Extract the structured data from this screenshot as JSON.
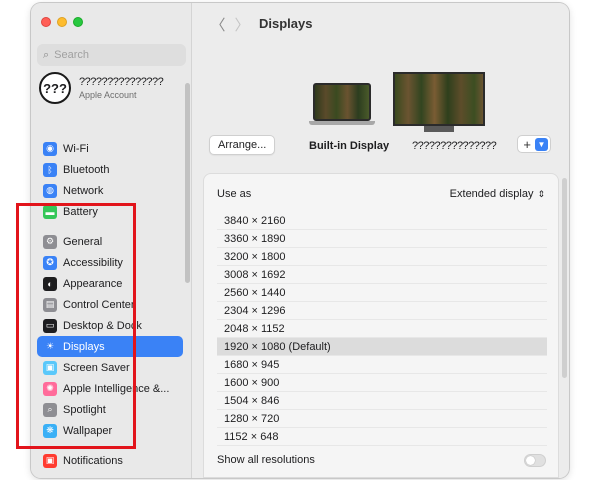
{
  "window": {
    "title": "Displays"
  },
  "search": {
    "placeholder": "Search"
  },
  "account": {
    "avatar_text": "???",
    "name": "???????????????",
    "subtitle": "Apple Account"
  },
  "sidebar": {
    "items": [
      {
        "label": "Wi-Fi",
        "icon": "wifi-icon",
        "color": "#3a82f6",
        "glyph": "◉",
        "name": "sidebar-item-wifi",
        "selected": false,
        "gap_before": false
      },
      {
        "label": "Bluetooth",
        "icon": "bluetooth-icon",
        "color": "#3a82f6",
        "glyph": "ᛒ",
        "name": "sidebar-item-bluetooth",
        "selected": false,
        "gap_before": false
      },
      {
        "label": "Network",
        "icon": "network-icon",
        "color": "#3a82f6",
        "glyph": "◍",
        "name": "sidebar-item-network",
        "selected": false,
        "gap_before": false
      },
      {
        "label": "Battery",
        "icon": "battery-icon",
        "color": "#34c759",
        "glyph": "▬",
        "name": "sidebar-item-battery",
        "selected": false,
        "gap_before": false
      },
      {
        "label": "General",
        "icon": "gear-icon",
        "color": "#8e8e93",
        "glyph": "⚙",
        "name": "sidebar-item-general",
        "selected": false,
        "gap_before": true
      },
      {
        "label": "Accessibility",
        "icon": "accessibility-icon",
        "color": "#3a82f6",
        "glyph": "✪",
        "name": "sidebar-item-accessibility",
        "selected": false,
        "gap_before": false
      },
      {
        "label": "Appearance",
        "icon": "appearance-icon",
        "color": "#1d1d1f",
        "glyph": "◐",
        "name": "sidebar-item-appearance",
        "selected": false,
        "gap_before": false
      },
      {
        "label": "Control Center",
        "icon": "control-center-icon",
        "color": "#8e8e93",
        "glyph": "▤",
        "name": "sidebar-item-control-center",
        "selected": false,
        "gap_before": false
      },
      {
        "label": "Desktop & Dock",
        "icon": "desktop-dock-icon",
        "color": "#1d1d1f",
        "glyph": "▭",
        "name": "sidebar-item-desktop-dock",
        "selected": false,
        "gap_before": false
      },
      {
        "label": "Displays",
        "icon": "displays-icon",
        "color": "#3a82f6",
        "glyph": "☀",
        "name": "sidebar-item-displays",
        "selected": true,
        "gap_before": false
      },
      {
        "label": "Screen Saver",
        "icon": "screen-saver-icon",
        "color": "#5ac8fa",
        "glyph": "▣",
        "name": "sidebar-item-screen-saver",
        "selected": false,
        "gap_before": false
      },
      {
        "label": "Apple Intelligence &...",
        "icon": "apple-intelligence-icon",
        "color": "#ff6b9a",
        "glyph": "✺",
        "name": "sidebar-item-apple-intelligence",
        "selected": false,
        "gap_before": false
      },
      {
        "label": "Spotlight",
        "icon": "spotlight-icon",
        "color": "#8e8e93",
        "glyph": "⌕",
        "name": "sidebar-item-spotlight",
        "selected": false,
        "gap_before": false
      },
      {
        "label": "Wallpaper",
        "icon": "wallpaper-icon",
        "color": "#3ab0f6",
        "glyph": "❋",
        "name": "sidebar-item-wallpaper",
        "selected": false,
        "gap_before": false
      },
      {
        "label": "Notifications",
        "icon": "notifications-icon",
        "color": "#ff3b30",
        "glyph": "▣",
        "name": "sidebar-item-notifications",
        "selected": false,
        "gap_before": true
      }
    ]
  },
  "displays": {
    "arrange_label": "Arrange...",
    "builtin_label": "Built-in Display",
    "external_label": "???????????????",
    "add_label": "+"
  },
  "settings": {
    "use_as_label": "Use as",
    "use_as_value": "Extended display",
    "resolutions": [
      "3840 × 2160",
      "3360 × 1890",
      "3200 × 1800",
      "3008 × 1692",
      "2560 × 1440",
      "2304 × 1296",
      "2048 × 1152",
      "1920 × 1080 (Default)",
      "1680 × 945",
      "1600 × 900",
      "1504 × 846",
      "1280 × 720",
      "1152 × 648"
    ],
    "selected_resolution": "1920 × 1080 (Default)",
    "show_all_label": "Show all resolutions",
    "show_all_enabled": false
  },
  "colors": {
    "accent": "#3a82f6",
    "highlight_box": "#e2141b"
  }
}
